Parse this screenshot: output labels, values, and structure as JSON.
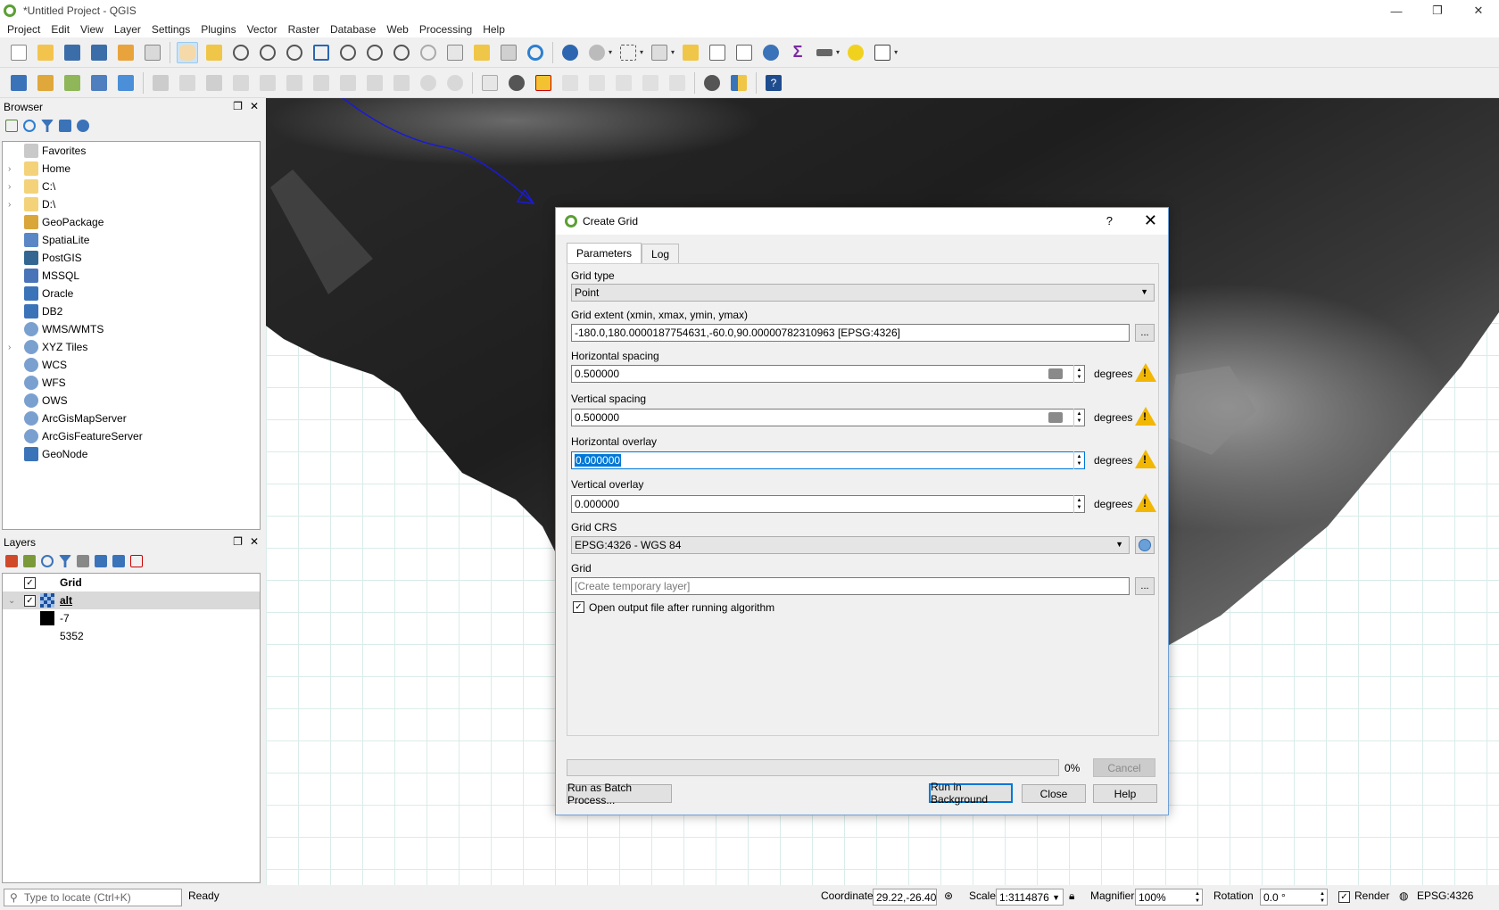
{
  "window": {
    "title": "*Untitled Project - QGIS",
    "minimize": "—",
    "restore": "❐",
    "close": "✕"
  },
  "menu": [
    "Project",
    "Edit",
    "View",
    "Layer",
    "Settings",
    "Plugins",
    "Vector",
    "Raster",
    "Database",
    "Web",
    "Processing",
    "Help"
  ],
  "browser": {
    "title": "Browser",
    "items": [
      {
        "label": "Favorites",
        "icon": "star-icon",
        "arrow": ""
      },
      {
        "label": "Home",
        "icon": "folder-icon",
        "arrow": "›"
      },
      {
        "label": "C:\\",
        "icon": "folder-icon",
        "arrow": "›"
      },
      {
        "label": "D:\\",
        "icon": "folder-icon",
        "arrow": "›"
      },
      {
        "label": "GeoPackage",
        "icon": "geopackage-icon",
        "arrow": ""
      },
      {
        "label": "SpatiaLite",
        "icon": "spatialite-icon",
        "arrow": ""
      },
      {
        "label": "PostGIS",
        "icon": "postgis-icon",
        "arrow": ""
      },
      {
        "label": "MSSQL",
        "icon": "mssql-icon",
        "arrow": ""
      },
      {
        "label": "Oracle",
        "icon": "oracle-icon",
        "arrow": ""
      },
      {
        "label": "DB2",
        "icon": "db2-icon",
        "arrow": ""
      },
      {
        "label": "WMS/WMTS",
        "icon": "globe-icon",
        "arrow": ""
      },
      {
        "label": "XYZ Tiles",
        "icon": "globe-icon",
        "arrow": "›"
      },
      {
        "label": "WCS",
        "icon": "globe-icon",
        "arrow": ""
      },
      {
        "label": "WFS",
        "icon": "globe-icon",
        "arrow": ""
      },
      {
        "label": "OWS",
        "icon": "globe-icon",
        "arrow": ""
      },
      {
        "label": "ArcGisMapServer",
        "icon": "globe-icon",
        "arrow": ""
      },
      {
        "label": "ArcGisFeatureServer",
        "icon": "globe-icon",
        "arrow": ""
      },
      {
        "label": "GeoNode",
        "icon": "geonode-icon",
        "arrow": ""
      }
    ]
  },
  "layers": {
    "title": "Layers",
    "items": [
      {
        "label": "Grid",
        "checked": "✓"
      },
      {
        "label": "alt",
        "checked": "✓"
      }
    ],
    "legend": [
      "-7",
      "5352"
    ]
  },
  "dialog": {
    "title": "Create Grid",
    "help": "?",
    "close": "✕",
    "tabs": [
      "Parameters",
      "Log"
    ],
    "grid_type_label": "Grid type",
    "grid_type_value": "Point",
    "extent_label": "Grid extent (xmin, xmax, ymin, ymax)",
    "extent_value": "-180.0,180.0000187754631,-60.0,90.00000782310963 [EPSG:4326]",
    "hspacing_label": "Horizontal spacing",
    "hspacing_value": "0.500000",
    "vspacing_label": "Vertical spacing",
    "vspacing_value": "0.500000",
    "hoverlay_label": "Horizontal overlay",
    "hoverlay_value": "0.000000",
    "voverlay_label": "Vertical overlay",
    "voverlay_value": "0.000000",
    "unit": "degrees",
    "crs_label": "Grid CRS",
    "crs_value": "EPSG:4326 - WGS 84",
    "output_label": "Grid",
    "output_placeholder": "[Create temporary layer]",
    "browse": "...",
    "open_output_label": "Open output file after running algorithm",
    "open_output_checked": "✓",
    "progress_percent": "0%",
    "progress_value": 0,
    "cancel": "Cancel",
    "batch": "Run as Batch Process...",
    "run_bg": "Run in Background",
    "close_btn": "Close",
    "help_btn": "Help"
  },
  "status": {
    "locate_placeholder": "Type to locate (Ctrl+K)",
    "ready": "Ready",
    "coordinate_label": "Coordinate",
    "coordinate_value": "29.22,-26.40",
    "scale_label": "Scale",
    "scale_value": "1:3114876",
    "magnifier_label": "Magnifier",
    "magnifier_value": "100%",
    "rotation_label": "Rotation",
    "rotation_value": "0.0 °",
    "render_label": "Render",
    "crs": "EPSG:4326"
  }
}
